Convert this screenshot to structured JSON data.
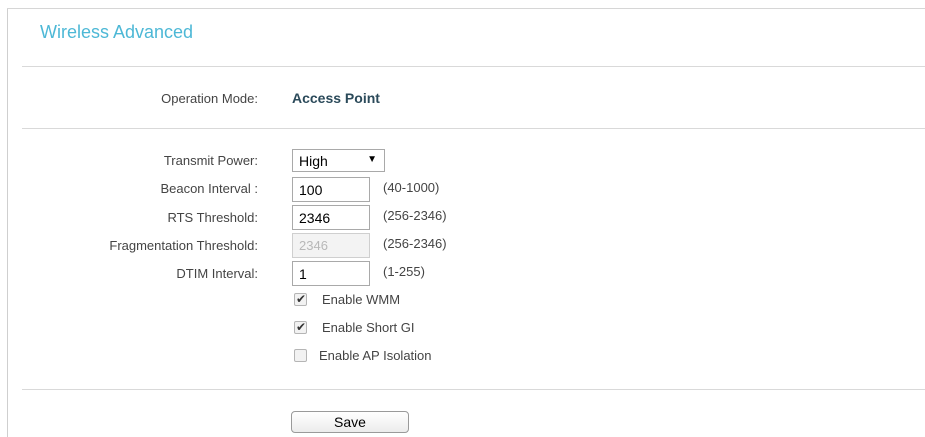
{
  "page": {
    "title": "Wireless Advanced"
  },
  "operation_mode": {
    "label": "Operation Mode:",
    "value": "Access Point"
  },
  "fields": {
    "transmit_power": {
      "label": "Transmit Power:",
      "value": "High",
      "arrow": "▼"
    },
    "beacon_interval": {
      "label": "Beacon Interval :",
      "value": "100",
      "range": "(40-1000)"
    },
    "rts_threshold": {
      "label": "RTS Threshold:",
      "value": "2346",
      "range": "(256-2346)"
    },
    "fragmentation_threshold": {
      "label": "Fragmentation Threshold:",
      "value": "2346",
      "range": "(256-2346)",
      "disabled": true
    },
    "dtim_interval": {
      "label": "DTIM Interval:",
      "value": "1",
      "range": "(1-255)"
    }
  },
  "options": {
    "enable_wmm": {
      "label": "Enable WMM",
      "checked": true
    },
    "enable_short_gi": {
      "label": "Enable Short GI",
      "checked": true
    },
    "enable_ap_isolation": {
      "label": "Enable AP Isolation",
      "checked": false
    }
  },
  "check_glyph": "✔",
  "buttons": {
    "save": "Save"
  },
  "colors": {
    "title": "#4db8d6",
    "mode_value": "#2b4a5a"
  }
}
